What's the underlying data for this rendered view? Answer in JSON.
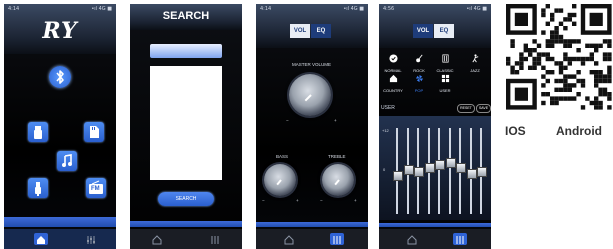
{
  "screen1": {
    "time": "4:14",
    "signal": "•ıl 4G ■",
    "logo": "RY",
    "icons": [
      "bluetooth-icon",
      "usb-drive-icon",
      "sd-card-icon",
      "music-note-icon",
      "aux-cable-icon",
      "fm-radio-icon"
    ],
    "fm_label": "FM"
  },
  "screen2": {
    "title": "SEARCH",
    "search_button": "SEARCH"
  },
  "screen3": {
    "time": "4:14",
    "signal": "•ıl 4G ■",
    "tabs": [
      "VOL",
      "EQ"
    ],
    "master_label": "MASTER VOLUME",
    "bass_label": "BASS",
    "treble_label": "TREBLE",
    "minus": "−",
    "plus": "+"
  },
  "screen4": {
    "time": "4:56",
    "signal": "•ıl 4G ■",
    "tabs": [
      "VOL",
      "EQ"
    ],
    "presets": [
      "NORMAL",
      "ROCK",
      "CLASSIC",
      "JAZZ",
      "COUNTRY",
      "POP",
      "USER"
    ],
    "user_label": "USER",
    "reset": "RESET",
    "save": "SAVE",
    "top_value": "+12",
    "mid_value": "0",
    "band_levels": [
      0.45,
      0.52,
      0.5,
      0.55,
      0.58,
      0.6,
      0.55,
      0.48,
      0.5
    ]
  },
  "qr": {
    "ios_label": "IOS",
    "android_label": "Android"
  },
  "colors": {
    "accent": "#2f63d6",
    "tab_active": "#e8edf5",
    "tab_inactive": "#1e3c7a"
  }
}
